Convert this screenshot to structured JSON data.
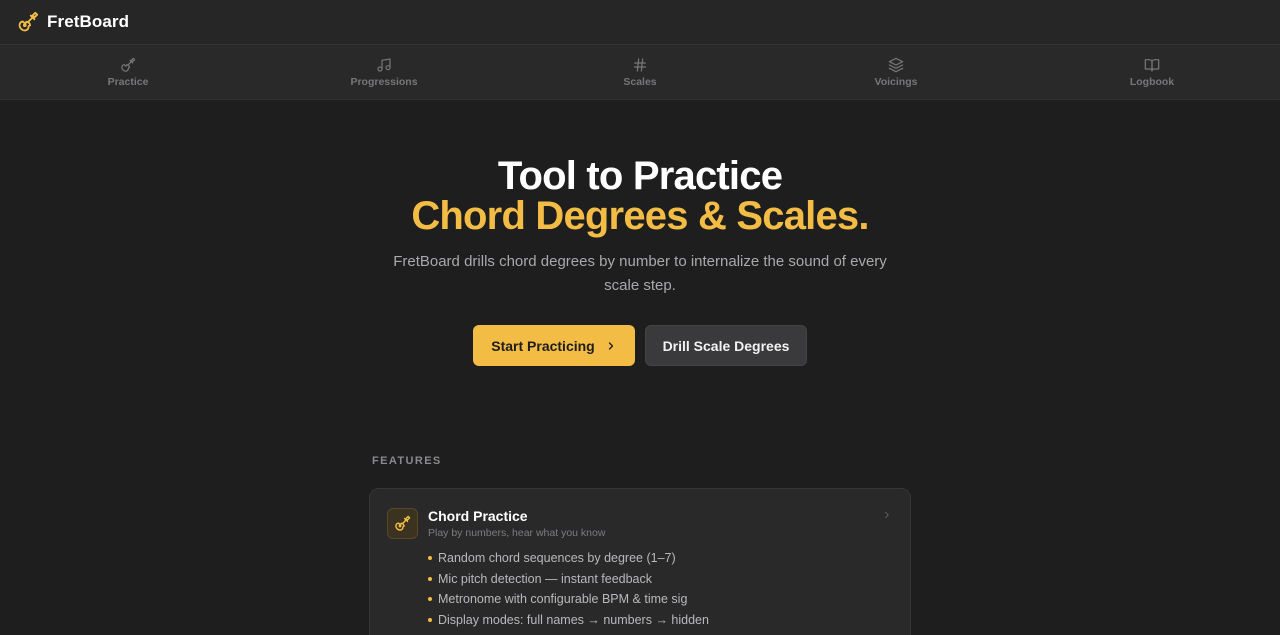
{
  "app": {
    "name": "FretBoard",
    "logo_icon": "guitar-icon",
    "accent_color": "#f3bc45"
  },
  "nav": {
    "items": [
      {
        "label": "Practice",
        "icon": "guitar-icon"
      },
      {
        "label": "Progressions",
        "icon": "music-note-icon"
      },
      {
        "label": "Scales",
        "icon": "hash-icon"
      },
      {
        "label": "Voicings",
        "icon": "layers-icon"
      },
      {
        "label": "Logbook",
        "icon": "book-icon"
      }
    ]
  },
  "hero": {
    "title_line1": "Tool to Practice",
    "title_line2": "Chord Degrees & Scales.",
    "subtitle": "FretBoard drills chord degrees by number to internalize the sound of every scale step.",
    "primary_button": "Start Practicing",
    "secondary_button": "Drill Scale Degrees"
  },
  "features": {
    "section_label": "FEATURES",
    "cards": [
      {
        "title": "Chord Practice",
        "subtitle": "Play by numbers, hear what you know",
        "icon": "guitar-icon",
        "bullets": [
          "Random chord sequences by degree (1–7)",
          "Mic pitch detection — instant feedback",
          "Metronome with configurable BPM & time sig",
          "Display modes: full names → numbers → hidden"
        ]
      }
    ]
  }
}
